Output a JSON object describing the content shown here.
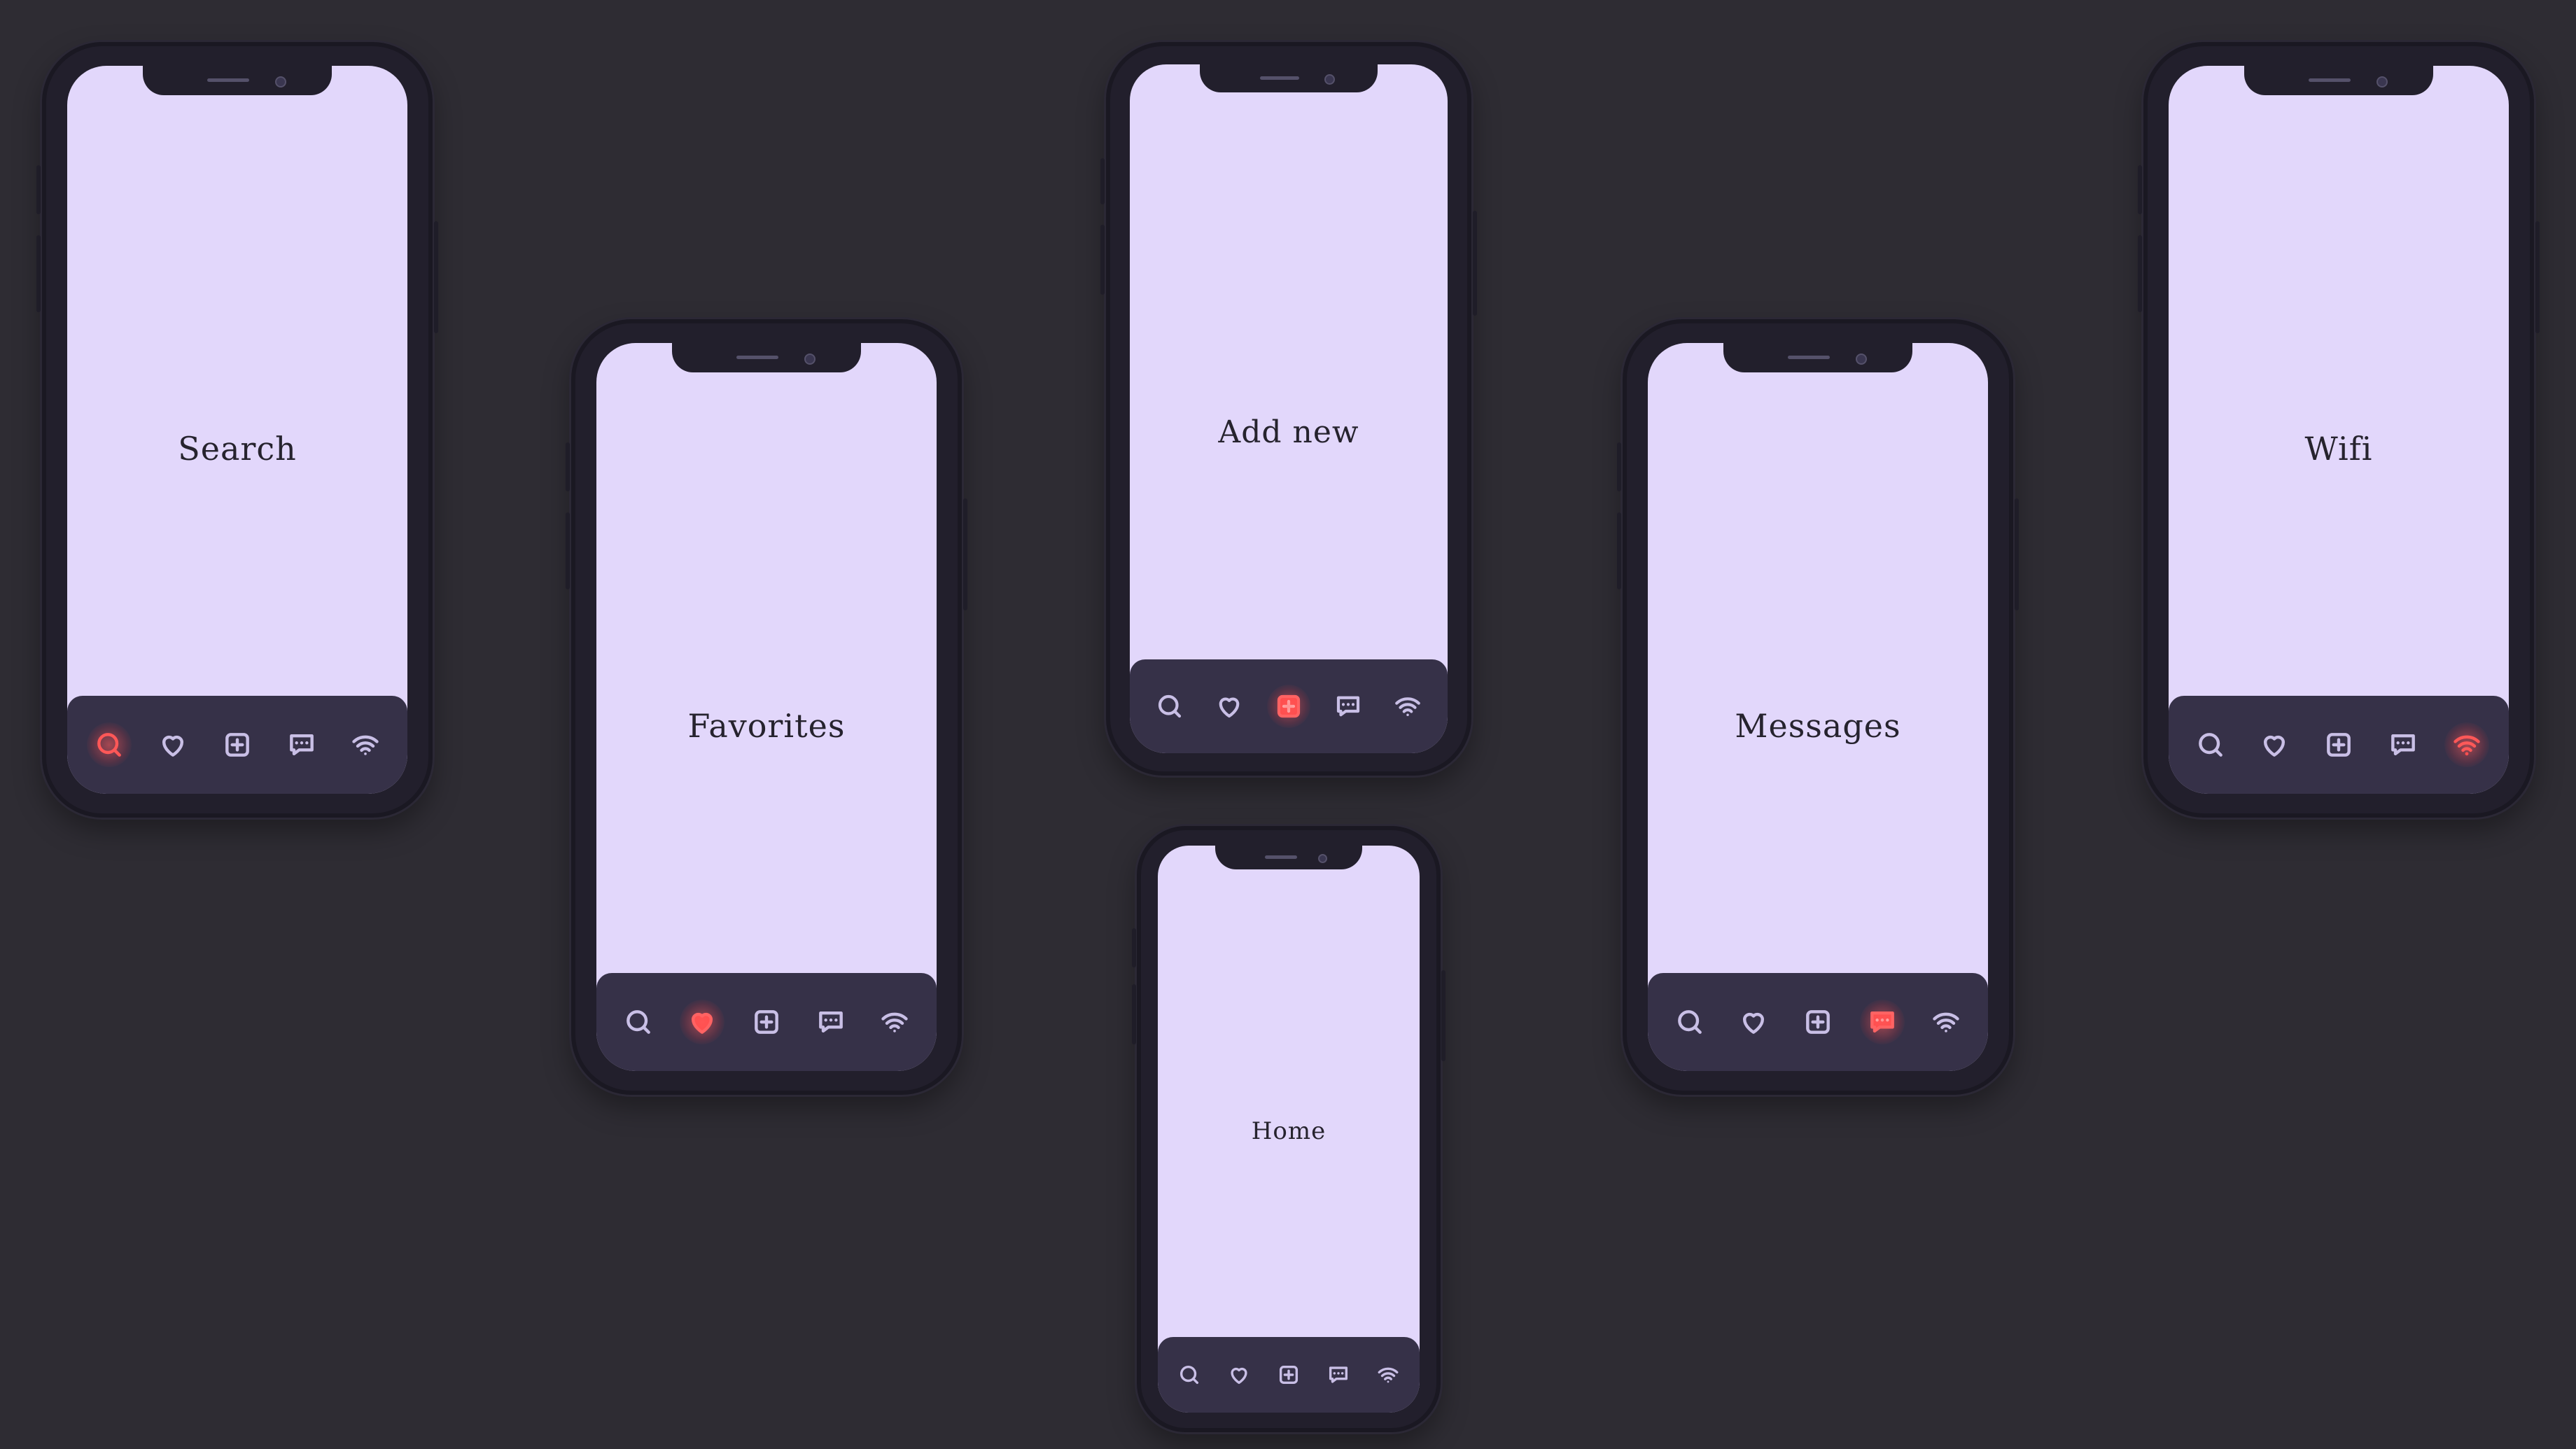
{
  "colors": {
    "background": "#2e2c33",
    "screen": "#e2d7fb",
    "navbar": "#363148",
    "icon": "#c9bfe6",
    "active_icon": "#ff4d4d"
  },
  "nav_icons": [
    "search-icon",
    "heart-icon",
    "add-square-icon",
    "message-icon",
    "wifi-icon"
  ],
  "phones": [
    {
      "id": "search",
      "title": "Search",
      "active": "search-icon"
    },
    {
      "id": "favorites",
      "title": "Favorites",
      "active": "heart-icon"
    },
    {
      "id": "add-new",
      "title": "Add new",
      "active": "add-square-icon"
    },
    {
      "id": "home",
      "title": "Home",
      "active": ""
    },
    {
      "id": "messages",
      "title": "Messages",
      "active": "message-icon"
    },
    {
      "id": "wifi",
      "title": "Wifi",
      "active": "wifi-icon"
    }
  ]
}
